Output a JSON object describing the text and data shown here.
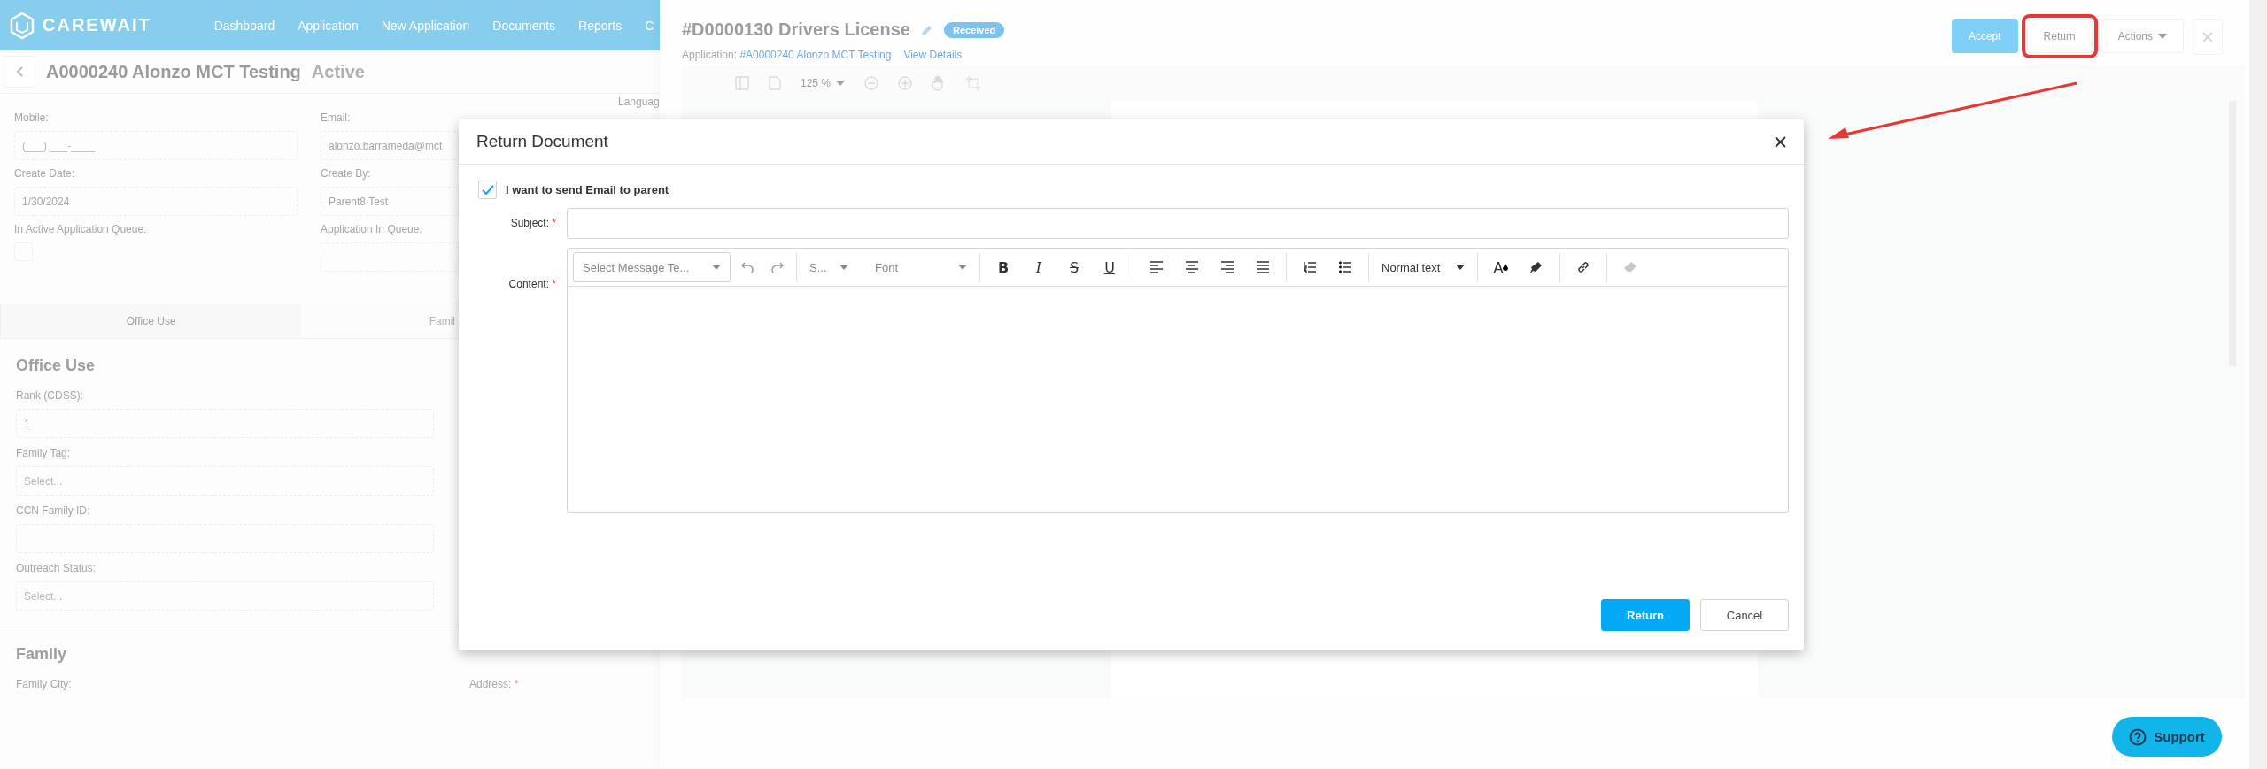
{
  "nav": {
    "logo": "CAREWAIT",
    "items": [
      "Dashboard",
      "Application",
      "New Application",
      "Documents",
      "Reports",
      "C"
    ]
  },
  "record": {
    "title": "A0000240 Alonzo MCT Testing",
    "status": "Active"
  },
  "summary_fields": [
    {
      "label": "Mobile:",
      "placeholder": "(___) ___-____",
      "kind": "text"
    },
    {
      "label": "Email:",
      "value": "alonzo.barrameda@mct",
      "kind": "text"
    },
    {
      "label": "Create Date:",
      "value": "1/30/2024",
      "kind": "text"
    },
    {
      "label": "Create By:",
      "value": "Parent8 Test",
      "kind": "text"
    },
    {
      "label": "In Active Application Queue:",
      "kind": "checkbox",
      "checked": false
    },
    {
      "label": "Application In Queue:",
      "kind": "text"
    }
  ],
  "language_label": "Languag",
  "tabs": [
    {
      "label": "Office Use",
      "selected": true
    },
    {
      "label": "Famil",
      "selected": false
    }
  ],
  "office_use": {
    "heading": "Office Use",
    "fields": [
      {
        "label": "Rank (CDSS):",
        "value": "1"
      },
      {
        "label": "Family Tag:",
        "placeholder": "Select..."
      },
      {
        "label": "CCN Family ID:"
      },
      {
        "label": "Outreach Status:",
        "placeholder": "Select..."
      }
    ]
  },
  "family": {
    "heading": "Family",
    "fields": [
      {
        "label": "Family City:"
      },
      {
        "label": "Address:",
        "required_mark": "*"
      }
    ]
  },
  "document": {
    "title": "#D0000130 Drivers License",
    "status": "Received",
    "application_label": "Application:",
    "application_link": "#A0000240 Alonzo MCT Testing",
    "view_details": "View Details",
    "zoom": "125 %",
    "buttons": [
      {
        "label": "Accept",
        "kind": "primary"
      },
      {
        "label": "Return",
        "kind": "outline"
      },
      {
        "label": "Actions",
        "kind": "menu"
      }
    ]
  },
  "modal": {
    "title": "Return Document",
    "send_email": {
      "label": "I want to send Email to parent",
      "checked": true
    },
    "subject": {
      "label": "Subject:",
      "required_mark": "*"
    },
    "content": {
      "label": "Content:",
      "required_mark": "*"
    },
    "editor": {
      "template_placeholder": "Select Message Te...",
      "size": "S...",
      "font": "Font",
      "format_buttons": [
        {
          "label": "B",
          "kind": "bold"
        },
        {
          "label": "I",
          "kind": "italic"
        },
        {
          "label": "S",
          "kind": "strike"
        },
        {
          "label": "U",
          "kind": "underline"
        }
      ],
      "block_style": "Normal text",
      "text_color": "A"
    },
    "buttons": [
      {
        "label": "Return",
        "kind": "primary"
      },
      {
        "label": "Cancel",
        "kind": "secondary"
      }
    ]
  },
  "support": "Support"
}
